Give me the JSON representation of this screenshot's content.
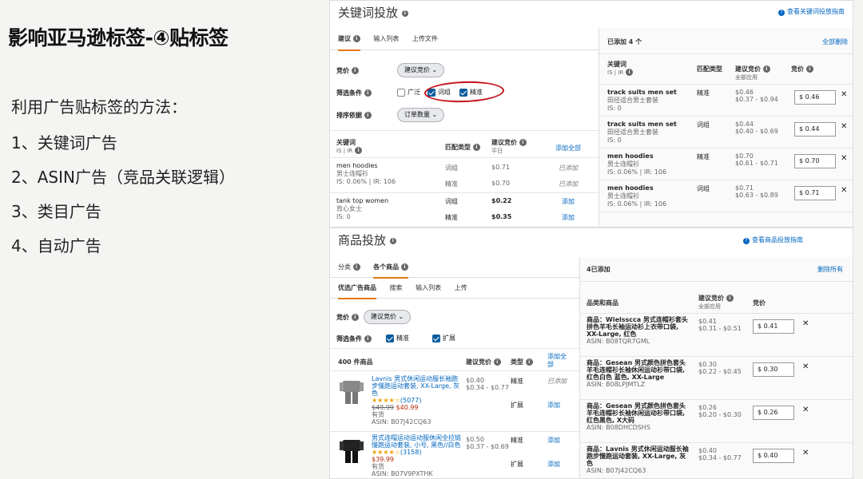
{
  "slide": {
    "title": "影响亚马逊标签-④贴标签",
    "intro": "利用广告贴标签的方法：",
    "methods": [
      "1、关键词广告",
      "2、ASIN广告（竞品关联逻辑）",
      "3、类目广告",
      "4、自动广告"
    ]
  },
  "kw": {
    "title": "关键词投放",
    "guide": "查看关键词投放指南",
    "tabs": [
      "建议",
      "输入列表",
      "上传文件"
    ],
    "bid_label": "竞价",
    "bid_dropdown": "建议竞价",
    "filter_label": "筛选条件",
    "filters": [
      {
        "label": "广泛",
        "checked": false
      },
      {
        "label": "词组",
        "checked": true
      },
      {
        "label": "精准",
        "checked": true
      }
    ],
    "sort_label": "排序依据",
    "sort_dropdown": "订单数量",
    "table_headers": {
      "keyword": "关键词",
      "keyword_sub": "IS | IR",
      "match": "匹配类型",
      "bid": "建议竞价",
      "bid_sub": "平日",
      "add_all": "添加全部"
    },
    "suggestions": [
      {
        "keyword": "men hoodies",
        "sub": "男士连帽衫",
        "stats": "IS: 0.06% | IR: 106",
        "rows": [
          {
            "match": "词组",
            "bid": "$0.71",
            "action": "已添加"
          },
          {
            "match": "精准",
            "bid": "$0.70",
            "action": "已添加"
          }
        ]
      },
      {
        "keyword": "tank top women",
        "sub": "背心女士",
        "stats": "IS: 0",
        "rows": [
          {
            "match": "词组",
            "bid": "$0.22",
            "action": "添加"
          },
          {
            "match": "精准",
            "bid": "$0.35",
            "action": "添加"
          }
        ]
      }
    ],
    "added_count": "已添加 4 个",
    "delete_all": "全部删除",
    "added_headers": {
      "keyword": "关键词",
      "keyword_sub": "IS | IR",
      "match": "匹配类型",
      "bid": "建议竞价",
      "bid_sub": "全部应用",
      "yourbid": "竞价"
    },
    "added": [
      {
        "keyword": "track suits men set",
        "sub": "田径适合男士套装",
        "stats": "IS: 0",
        "match": "精准",
        "sug": "$0.46",
        "range": "$0.37 - $0.94",
        "bid": "$ 0.46"
      },
      {
        "keyword": "track suits men set",
        "sub": "田径适合男士套装",
        "stats": "IS: 0",
        "match": "词组",
        "sug": "$0.44",
        "range": "$0.40 - $0.69",
        "bid": "$ 0.44"
      },
      {
        "keyword": "men hoodies",
        "sub": "男士连帽衫",
        "stats": "IS: 0.06% | IR: 106",
        "match": "精准",
        "sug": "$0.70",
        "range": "$0.61 - $0.71",
        "bid": "$ 0.70"
      },
      {
        "keyword": "men hoodies",
        "sub": "男士连帽衫",
        "stats": "IS: 0.06% | IR: 106",
        "match": "词组",
        "sug": "$0.71",
        "range": "$0.63 - $0.89",
        "bid": "$ 0.71"
      }
    ]
  },
  "pd": {
    "title": "商品投放",
    "guide": "查看商品投放指南",
    "tabs": [
      "分类",
      "各个商品"
    ],
    "subtabs": [
      "优选广告商品",
      "搜索",
      "输入列表",
      "上传"
    ],
    "bid_label": "竞价",
    "bid_dropdown": "建议竞价",
    "filter_label": "筛选条件",
    "filters": [
      {
        "label": "精准",
        "checked": true
      },
      {
        "label": "扩展",
        "checked": true
      }
    ],
    "count": "400 件商品",
    "headers": {
      "bid": "建议竞价",
      "type": "类型",
      "add_all": "添加全部"
    },
    "products": [
      {
        "title": "Lavnis 男式休闲运动服长袖跑步慢跑运动套装, XX-Large, 灰色",
        "stars": "★★★★☆",
        "reviews": "(5077)",
        "old_price": "$49.99",
        "price": "$40.99",
        "stock": "有货",
        "asin": "ASIN: B07J42CQ63",
        "rows": [
          {
            "bid": "$0.40",
            "range": "$0.34 - $0.77",
            "type": "精准",
            "action": "已添加"
          },
          {
            "bid": "",
            "range": "",
            "type": "扩展",
            "action": "添加"
          }
        ]
      },
      {
        "title": "男式连帽运动运动服休闲全拉链慢跑运动套装, 小号, 黑色//白色",
        "stars": "★★★★☆",
        "reviews": "(3158)",
        "old_price": "",
        "price": "$39.99",
        "stock": "有货",
        "asin": "ASIN: B07V9PXTHK",
        "rows": [
          {
            "bid": "$0.50",
            "range": "$0.37 - $0.69",
            "type": "精准",
            "action": "添加"
          },
          {
            "bid": "",
            "range": "",
            "type": "扩展",
            "action": "添加"
          }
        ]
      }
    ],
    "added_count": "4已添加",
    "delete_all": "删除所有",
    "added_headers": {
      "product": "品类和商品",
      "bid": "建议竞价",
      "bid_sub": "全部应用",
      "yourbid": "竞价"
    },
    "added": [
      {
        "title": "商品：Wielsscca 男式连帽衫套头拼色羊毛长袖运动衫上衣带口袋, XX-Large, 红色",
        "asin": "ASIN: B08TQR7GML",
        "sug": "$0.41",
        "range": "$0.31 - $0.51",
        "bid": "$ 0.41"
      },
      {
        "title": "商品：Gesean 男式颜色拼色套头羊毛连帽衫长袖休闲运动衫带口袋, 红色白色 蓝色, XX-Large",
        "asin": "ASIN: B08LPJMTLZ",
        "sug": "$0.30",
        "range": "$0.22 - $0.45",
        "bid": "$ 0.30"
      },
      {
        "title": "商品：Gesean 男式颜色拼色套头羊毛连帽衫长袖休闲运动衫带口袋, 红色黑色, X大码",
        "asin": "ASIN: B08DHCDSHS",
        "sug": "$0.26",
        "range": "$0.20 - $0.30",
        "bid": "$ 0.26"
      },
      {
        "title": "商品：Lavnis 男式休闲运动服长袖跑步慢跑运动套装, XX-Large, 灰色",
        "asin": "ASIN: B07J42CQ63",
        "sug": "$0.40",
        "range": "$0.34 - $0.77",
        "bid": "$ 0.40"
      }
    ]
  },
  "colors": {
    "accent": "#e47911",
    "link": "#0066c0",
    "checkbox": "#0a5c9c",
    "annotation": "#c4121a"
  }
}
